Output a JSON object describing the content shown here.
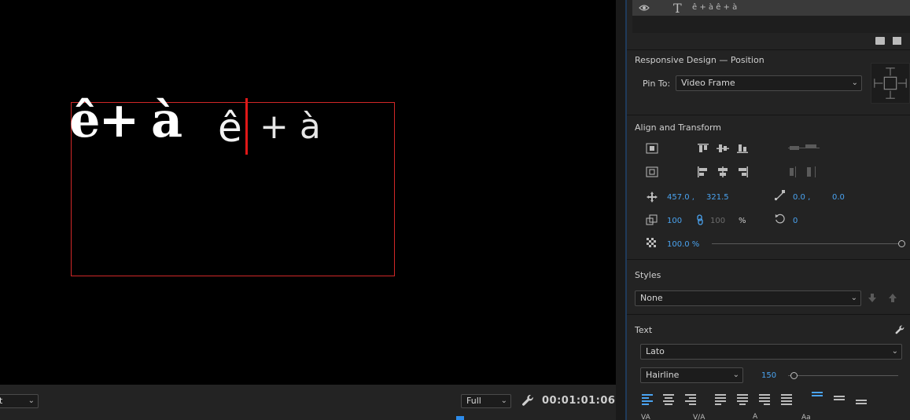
{
  "monitor": {
    "text_bold_left": "ê+",
    "text_bold_mid": "à",
    "text_light_1": "ê",
    "text_light_2": "+ à",
    "zoom_value": "t",
    "quality_value": "Full",
    "timecode": "00:01:01:06",
    "colors": {
      "bbox": "#d12828",
      "caret": "#e01818",
      "background": "#000000"
    }
  },
  "panel": {
    "layer_name": "ê + à  ê + à",
    "responsive_title": "Responsive Design — Position",
    "pin_to_label": "Pin To:",
    "pin_to_value": "Video Frame",
    "align_title": "Align and Transform",
    "position_x": "457.0 ,",
    "position_y": "321.5",
    "anchor_x": "0.0 ,",
    "anchor_y": "0.0",
    "scale": "100",
    "scale_linked": "100",
    "percent": "%",
    "rotation": "0",
    "opacity": "100.0 %",
    "styles_title": "Styles",
    "styles_value": "None",
    "text_title": "Text",
    "font_value": "Lato",
    "weight_value": "Hairline",
    "font_size": "150",
    "accent_color": "#4aa3f0"
  }
}
